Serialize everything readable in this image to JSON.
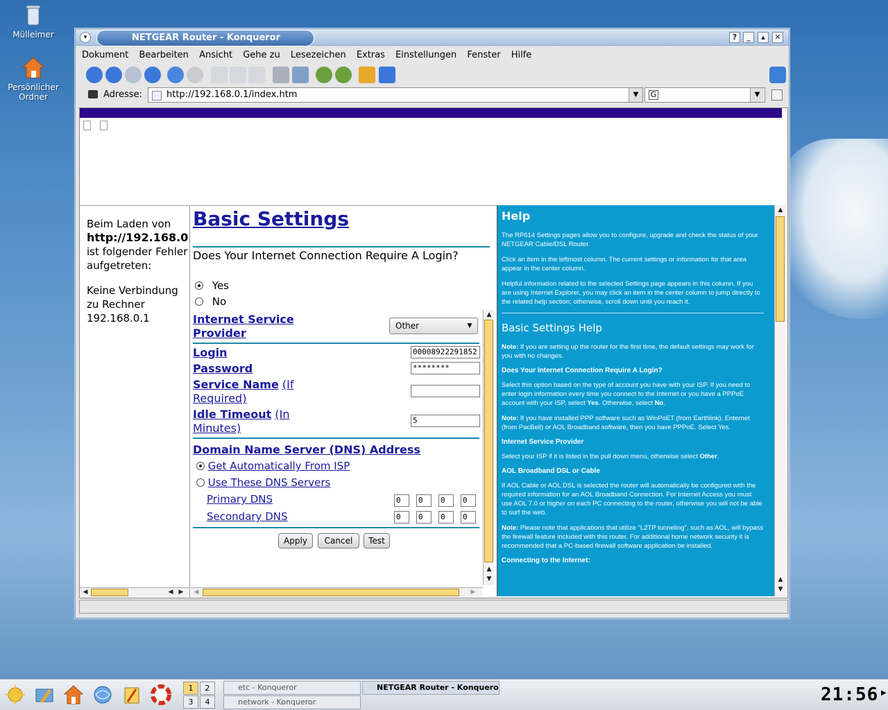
{
  "desktop": {
    "icons": [
      {
        "label": "Mülleimer"
      },
      {
        "label": "Persönlicher Ordner"
      }
    ]
  },
  "window": {
    "title": "NETGEAR Router - Konqueror",
    "menu": [
      "Dokument",
      "Bearbeiten",
      "Ansicht",
      "Gehe zu",
      "Lesezeichen",
      "Extras",
      "Einstellungen",
      "Fenster",
      "Hilfe"
    ],
    "address_label": "Adresse:",
    "url": "http://192.168.0.1/index.htm",
    "search_value": ""
  },
  "left_frame": {
    "error_line1": "Beim Laden von",
    "error_url": "http://192.168.0",
    "error_line3": "ist folgender Fehler aufgetreten:",
    "error_line4": "Keine Verbindung zu Rechner 192.168.0.1"
  },
  "settings": {
    "title": "Basic Settings",
    "question": "Does Your Internet Connection Require A Login?",
    "opt_yes": "Yes",
    "opt_no": "No",
    "isp_label": "Internet Service Provider",
    "isp_value": "Other",
    "login_label": "Login",
    "login_value": "00008922291852",
    "password_label": "Password",
    "password_value": "********",
    "service_label": "Service Name",
    "service_suffix": "(If Required)",
    "service_value": "",
    "idle_label": "Idle Timeout",
    "idle_suffix": "(In Minutes)",
    "idle_value": "5",
    "dns_title": "Domain Name Server (DNS) Address",
    "dns_auto": "Get Automatically From ISP",
    "dns_manual": "Use These DNS Servers",
    "primary_dns": "Primary DNS",
    "secondary_dns": "Secondary DNS",
    "primary_values": [
      "0",
      "0",
      "0",
      "0"
    ],
    "secondary_values": [
      "0",
      "0",
      "0",
      "0"
    ],
    "apply": "Apply",
    "cancel": "Cancel",
    "test": "Test"
  },
  "help": {
    "title": "Help",
    "p1": "The RP614 Settings pages allow you to configure, upgrade and check the status of your NETGEAR Cable/DSL Router.",
    "p2": "Click an item in the leftmost column. The current settings or information for that area appear in the center column.",
    "p3": "Helpful information related to the selected Settings page appears in this column. If you are using Internet Explorer, you may click an item in the center column to jump directly to the related help section; otherwise, scroll down until you reach it.",
    "title2": "Basic Settings Help",
    "note1_label": "Note:",
    "note1": "If you are setting up the router for the first time, the default settings may work for you with no changes.",
    "h_login": "Does Your Internet Connection Require A Login?",
    "p_login": "Select this option based on the type of account you have with your ISP. If you need to enter login information every time you connect to the Internet or you have a PPPoE account with your ISP, select",
    "p_login_yes": "Yes",
    "p_login_mid": ". Otherwise, select",
    "p_login_no": "No",
    "note2_label": "Note:",
    "note2": "If you have installed PPP software such as WinPoET (from Earthlink), Enternet (from PacBell) or AOL Broadband software, then you have PPPoE. Select Yes.",
    "h_isp": "Internet Service Provider",
    "p_isp": "Select your ISP if it is listed in the pull down menu, otherwise select",
    "p_isp_other": "Other",
    "h_aol": "AOL Broadband DSL or Cable",
    "p_aol": "If AOL Cable or AOL DSL is selected the router will automatically be configured with the required information for an AOL Broadband Connection. For Internet Access you must use AOL 7.0 or higher on each PC connecting to the router, otherwise you will not be able to surf the web.",
    "note3_label": "Note:",
    "note3": "Please note that applications that utilize \"L2TP tunneling\", such as AOL, will bypass the firewall feature included with this router. For additional home network security it is recommended that a PC-based firewall software application be installed.",
    "h_connect": "Connecting to the Internet:"
  },
  "taskbar": {
    "desktops": [
      "1",
      "2",
      "3",
      "4"
    ],
    "tasks": [
      "etc - Konqueror",
      "NETGEAR Router - Konqueror",
      "network - Konqueror"
    ],
    "clock": "21:56"
  }
}
